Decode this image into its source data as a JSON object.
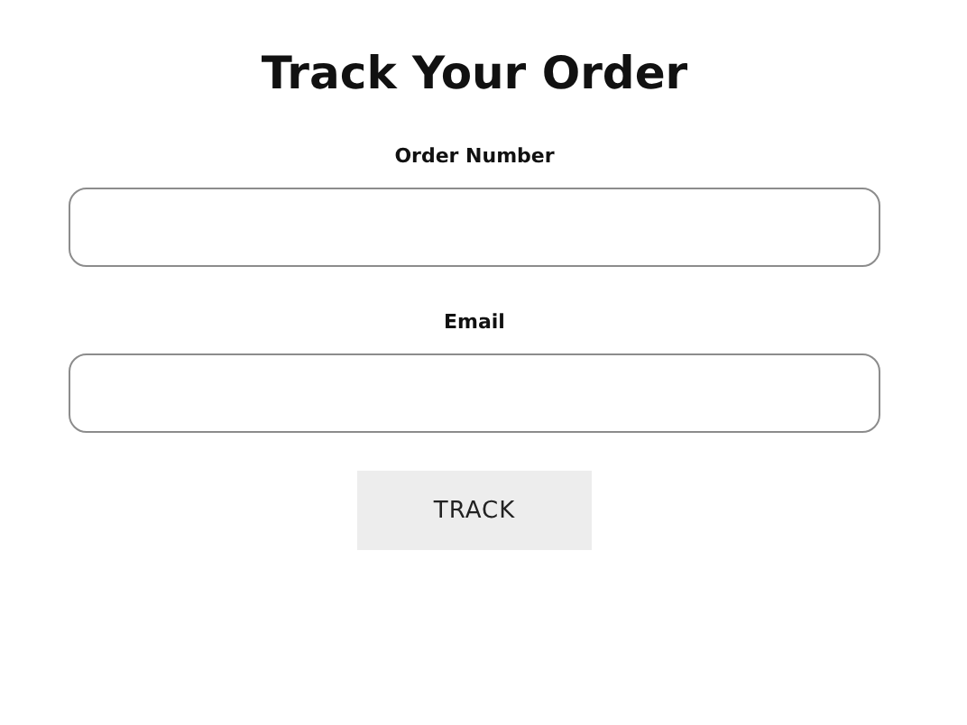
{
  "title": "Track Your Order",
  "fields": [
    {
      "label": "Order Number"
    },
    {
      "label": "Email"
    }
  ],
  "button": "TRACK"
}
